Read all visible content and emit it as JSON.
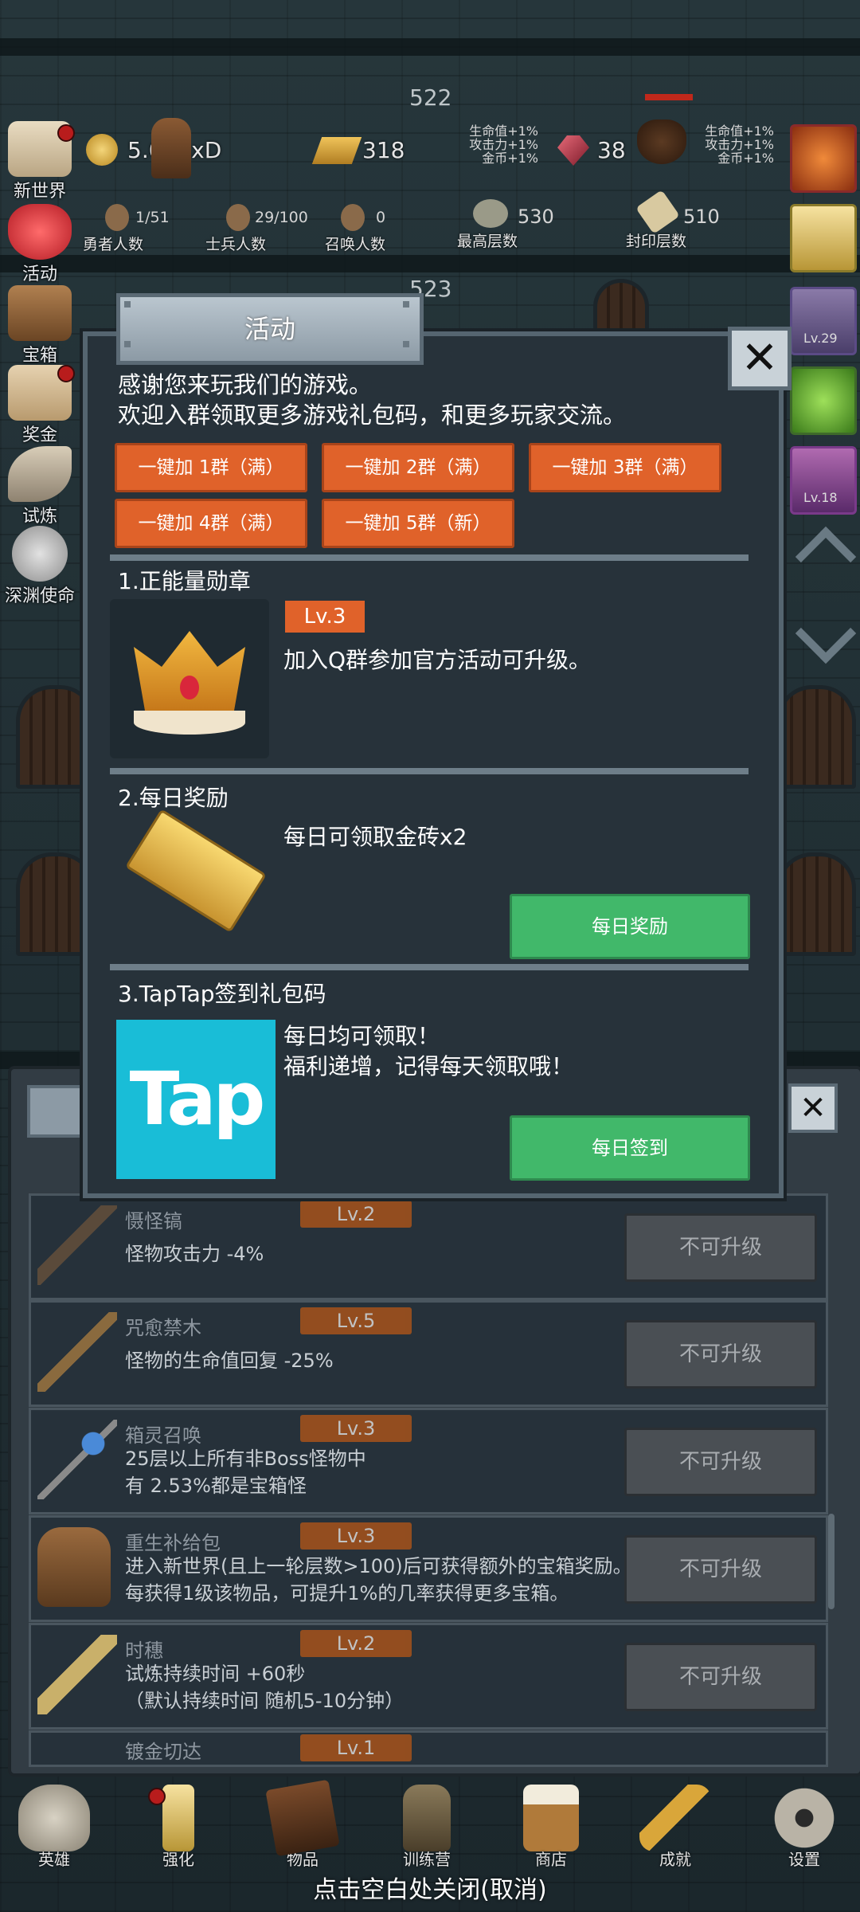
{
  "floors": {
    "upper": "522",
    "lower": "523"
  },
  "resources": {
    "gold": "5.05SxD",
    "brick": "318",
    "gem": "38",
    "buff_left": [
      "生命值+1%",
      "攻击力+1%",
      "金币+1%"
    ],
    "buff_right": [
      "生命值+1%",
      "攻击力+1%",
      "金币+1%"
    ]
  },
  "counts": [
    {
      "value": "1/51",
      "label": "勇者人数"
    },
    {
      "value": "29/100",
      "label": "士兵人数"
    },
    {
      "value": "0",
      "label": "召唤人数"
    },
    {
      "value": "530",
      "label": "最高层数"
    },
    {
      "value": "510",
      "label": "封印层数"
    }
  ],
  "side_menu": [
    {
      "label": "新世界",
      "icon": "map-icon"
    },
    {
      "label": "活动",
      "icon": "heart-icon"
    },
    {
      "label": "宝箱",
      "icon": "chest-icon"
    },
    {
      "label": "奖金",
      "icon": "envelope-icon"
    },
    {
      "label": "试炼",
      "icon": "feather-icon"
    },
    {
      "label": "深渊使命",
      "icon": "orb-icon"
    }
  ],
  "right_icons": {
    "lv1": "Lv.29",
    "lv2": "Lv.18"
  },
  "modal": {
    "title": "活动",
    "close": "✕",
    "intro_line1": "感谢您来玩我们的游戏。",
    "intro_line2": "欢迎入群领取更多游戏礼包码，和更多玩家交流。",
    "groups": [
      "一键加 1群（满）",
      "一键加 2群（满）",
      "一键加 3群（满）",
      "一键加 4群（满）",
      "一键加 5群（新）"
    ],
    "sec1_title": "1.正能量勋章",
    "sec1_lv": "Lv.3",
    "sec1_desc": "加入Q群参加官方活动可升级。",
    "sec2_title": "2.每日奖励",
    "sec2_desc": "每日可领取金砖x2",
    "sec2_button": "每日奖励",
    "sec3_title": "3.TapTap签到礼包码",
    "sec3_desc1": "每日均可领取！",
    "sec3_desc2": "福利递增，记得每天领取哦！",
    "sec3_button": "每日签到",
    "tap_logo": "Tap"
  },
  "upgrades": [
    {
      "name": "慑怪镐",
      "lv": "Lv.2",
      "desc1": "怪物攻击力 -4%",
      "desc2": "",
      "button": "不可升级"
    },
    {
      "name": "咒愈禁木",
      "lv": "Lv.5",
      "desc1": "怪物的生命值回复 -25%",
      "desc2": "",
      "button": "不可升级"
    },
    {
      "name": "箱灵召唤",
      "lv": "Lv.3",
      "desc1": "25层以上所有非Boss怪物中",
      "desc2": "有 2.53%都是宝箱怪",
      "button": "不可升级"
    },
    {
      "name": "重生补给包",
      "lv": "Lv.3",
      "desc1": "进入新世界(且上一轮层数>100)后可获得额外的宝箱奖励。",
      "desc2": "每获得1级该物品，可提升1%的几率获得更多宝箱。",
      "button": "不可升级"
    },
    {
      "name": "时穗",
      "lv": "Lv.2",
      "desc1": "试炼持续时间 +60秒",
      "desc2": "（默认持续时间 随机5-10分钟）",
      "button": "不可升级"
    },
    {
      "name": "镀金切达",
      "lv": "Lv.1",
      "desc1": "",
      "desc2": "",
      "button": ""
    }
  ],
  "bottom_nav": [
    {
      "label": "英雄",
      "icon": "skull-icon"
    },
    {
      "label": "强化",
      "icon": "candle-icon"
    },
    {
      "label": "物品",
      "icon": "book-icon"
    },
    {
      "label": "训练营",
      "icon": "lantern-icon"
    },
    {
      "label": "商店",
      "icon": "mug-icon"
    },
    {
      "label": "成就",
      "icon": "key-icon"
    },
    {
      "label": "设置",
      "icon": "gear-icon"
    }
  ],
  "close_hint": "点击空白处关闭(取消)",
  "colors": {
    "orange": "#e0622a",
    "green": "#41b86a",
    "tap_blue": "#19bdd7"
  }
}
